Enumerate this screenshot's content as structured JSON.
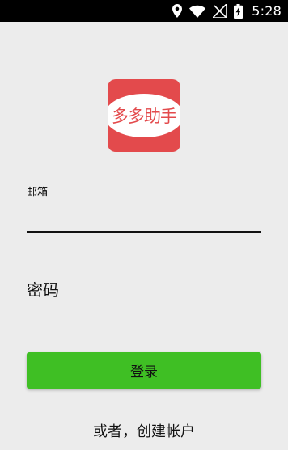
{
  "status_bar": {
    "time": "5:28",
    "icons": [
      "location-icon",
      "wifi-icon",
      "signal-off-icon",
      "battery-charging-icon"
    ]
  },
  "logo": {
    "text": "多多助手",
    "background_color": "#e34a4c",
    "text_color": "#e34a4c"
  },
  "form": {
    "email_label": "邮箱",
    "email_value": "",
    "password_placeholder": "密码",
    "password_value": ""
  },
  "login_button": {
    "label": "登录",
    "color": "#3fbf24"
  },
  "signup_link": {
    "label": "或者，创建帐户"
  },
  "colors": {
    "background": "#ececec",
    "status_bar": "#000000"
  }
}
